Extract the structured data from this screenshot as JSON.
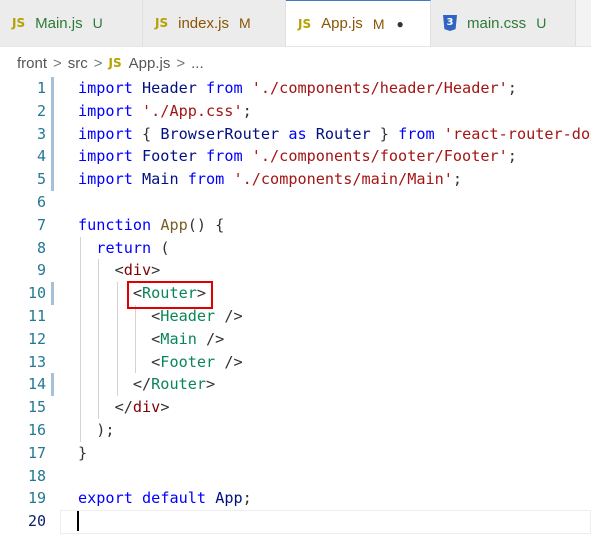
{
  "tabs": [
    {
      "icon": "JS",
      "label": "Main.js",
      "flag": "U",
      "status": "untracked"
    },
    {
      "icon": "JS",
      "label": "index.js",
      "flag": "M",
      "status": "modified"
    },
    {
      "icon": "JS",
      "label": "App.js",
      "flag": "M",
      "status": "modified",
      "active": true,
      "dirty_dot": "●"
    },
    {
      "icon": "3",
      "label": "main.css",
      "flag": "U",
      "status": "untracked"
    }
  ],
  "breadcrumb": {
    "parts": [
      "front",
      "src",
      "App.js",
      "..."
    ],
    "file_icon": "JS",
    "separator": ">"
  },
  "editor": {
    "line_numbers": [
      "1",
      "2",
      "3",
      "4",
      "5",
      "6",
      "7",
      "8",
      "9",
      "10",
      "11",
      "12",
      "13",
      "14",
      "15",
      "16",
      "17",
      "18",
      "19",
      "20"
    ],
    "current_line": "20",
    "lines": [
      [
        {
          "t": "import",
          "c": "kw"
        },
        {
          "t": " Header ",
          "c": "ident"
        },
        {
          "t": "from",
          "c": "kw"
        },
        {
          "t": " './components/header/Header'",
          "c": "str"
        },
        {
          "t": ";",
          "c": "punc"
        }
      ],
      [
        {
          "t": "import",
          "c": "kw"
        },
        {
          "t": " './App.css'",
          "c": "str"
        },
        {
          "t": ";",
          "c": "punc"
        }
      ],
      [
        {
          "t": "import",
          "c": "kw"
        },
        {
          "t": " { ",
          "c": "punc"
        },
        {
          "t": "BrowserRouter",
          "c": "ident"
        },
        {
          "t": " as ",
          "c": "kw"
        },
        {
          "t": "Router",
          "c": "ident"
        },
        {
          "t": " } ",
          "c": "punc"
        },
        {
          "t": "from",
          "c": "kw"
        },
        {
          "t": " 'react-router-dom'",
          "c": "str"
        },
        {
          "t": ";",
          "c": "punc"
        }
      ],
      [
        {
          "t": "import",
          "c": "kw"
        },
        {
          "t": " Footer ",
          "c": "ident"
        },
        {
          "t": "from",
          "c": "kw"
        },
        {
          "t": " './components/footer/Footer'",
          "c": "str"
        },
        {
          "t": ";",
          "c": "punc"
        }
      ],
      [
        {
          "t": "import",
          "c": "kw"
        },
        {
          "t": " Main ",
          "c": "ident"
        },
        {
          "t": "from",
          "c": "kw"
        },
        {
          "t": " './components/main/Main'",
          "c": "str"
        },
        {
          "t": ";",
          "c": "punc"
        }
      ],
      [],
      [
        {
          "t": "function",
          "c": "kw"
        },
        {
          "t": " ",
          "c": "punc"
        },
        {
          "t": "App",
          "c": "fn"
        },
        {
          "t": "() {",
          "c": "punc"
        }
      ],
      [
        {
          "t": "  ",
          "c": "punc"
        },
        {
          "t": "return",
          "c": "kw"
        },
        {
          "t": " (",
          "c": "punc"
        }
      ],
      [
        {
          "t": "    <",
          "c": "punc"
        },
        {
          "t": "div",
          "c": "tag"
        },
        {
          "t": ">",
          "c": "punc"
        }
      ],
      [
        {
          "t": "      <",
          "c": "punc"
        },
        {
          "t": "Router",
          "c": "jsx"
        },
        {
          "t": ">",
          "c": "punc"
        }
      ],
      [
        {
          "t": "        <",
          "c": "punc"
        },
        {
          "t": "Header",
          "c": "jsx"
        },
        {
          "t": " />",
          "c": "punc"
        }
      ],
      [
        {
          "t": "        <",
          "c": "punc"
        },
        {
          "t": "Main",
          "c": "jsx"
        },
        {
          "t": " />",
          "c": "punc"
        }
      ],
      [
        {
          "t": "        <",
          "c": "punc"
        },
        {
          "t": "Footer",
          "c": "jsx"
        },
        {
          "t": " />",
          "c": "punc"
        }
      ],
      [
        {
          "t": "      </",
          "c": "punc"
        },
        {
          "t": "Router",
          "c": "jsx"
        },
        {
          "t": ">",
          "c": "punc"
        }
      ],
      [
        {
          "t": "    </",
          "c": "punc"
        },
        {
          "t": "div",
          "c": "tag"
        },
        {
          "t": ">",
          "c": "punc"
        }
      ],
      [
        {
          "t": "  );",
          "c": "punc"
        }
      ],
      [
        {
          "t": "}",
          "c": "punc"
        }
      ],
      [],
      [
        {
          "t": "export",
          "c": "kw"
        },
        {
          "t": " ",
          "c": "punc"
        },
        {
          "t": "default",
          "c": "kw"
        },
        {
          "t": " App",
          "c": "ident"
        },
        {
          "t": ";",
          "c": "punc"
        }
      ],
      []
    ],
    "modified_lines": [
      "1",
      "2",
      "3",
      "4",
      "5",
      "10",
      "14"
    ],
    "highlighted_token": "<Router>"
  },
  "colors": {
    "keyword": "#0000ff",
    "string": "#a31515",
    "line_number": "#237893",
    "highlight_box": "#e00000"
  }
}
